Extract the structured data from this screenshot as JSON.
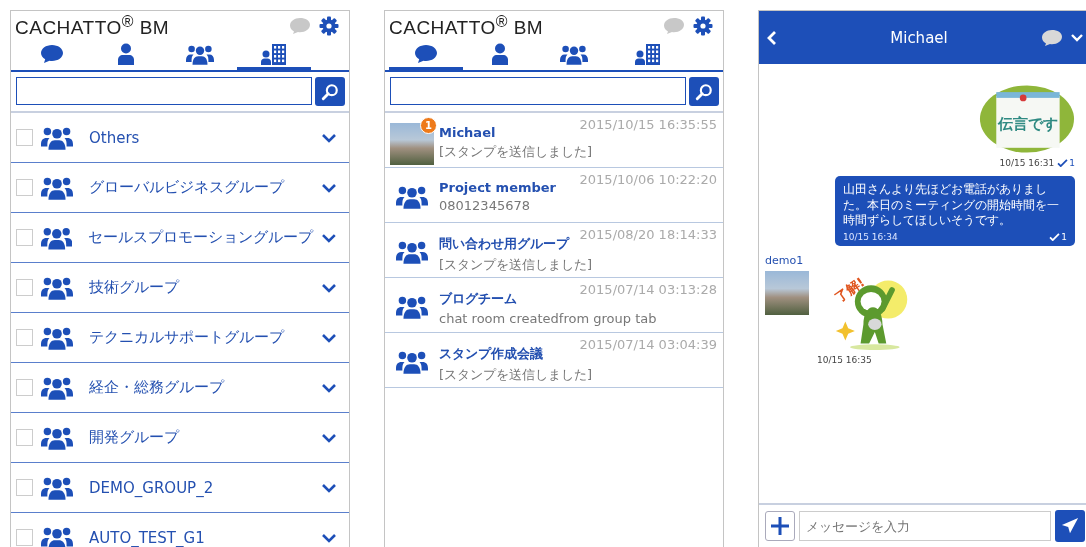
{
  "group_screen": {
    "logo": "CACHATTO$^{®}$ BM",
    "tabs": [
      {
        "kind": "chats",
        "selected": false
      },
      {
        "kind": "contacts",
        "selected": false
      },
      {
        "kind": "groups",
        "selected": false
      },
      {
        "kind": "organization",
        "selected": true
      }
    ],
    "groups": [
      {
        "name": "Others",
        "checked": false
      },
      {
        "name": "グローバルビジネスグループ",
        "checked": false
      },
      {
        "name": "セールスプロモーショングループ",
        "checked": false
      },
      {
        "name": "技術グループ",
        "checked": false
      },
      {
        "name": "テクニカルサポートグループ",
        "checked": false
      },
      {
        "name": "経企・総務グループ",
        "checked": false
      },
      {
        "name": "開発グループ",
        "checked": false
      },
      {
        "name": "DEMO_GROUP_2",
        "checked": false
      },
      {
        "name": "AUTO_TEST_G1",
        "checked": false
      }
    ]
  },
  "chat_list_screen": {
    "logo": "CACHATTO$^{®}$ BM",
    "tabs": [
      {
        "kind": "chats",
        "selected": true
      },
      {
        "kind": "contacts",
        "selected": false
      },
      {
        "kind": "groups",
        "selected": false
      },
      {
        "kind": "organization",
        "selected": false
      }
    ],
    "chats": [
      {
        "kind": "photo",
        "badge": "1",
        "name": "Michael",
        "time": "2015/10/15 16:35:55",
        "preview": "[スタンプを送信しました]"
      },
      {
        "kind": "group",
        "name": "Project member",
        "time": "2015/10/06 10:22:20",
        "preview": "08012345678"
      },
      {
        "kind": "group",
        "name": "問い合わせ用グループ",
        "time": "2015/08/20 18:14:33",
        "preview": "[スタンプを送信しました]"
      },
      {
        "kind": "group",
        "name": "ブログチーム",
        "time": "2015/07/14 03:13:28",
        "preview": "chat room createdfrom group tab"
      },
      {
        "kind": "group",
        "name": "スタンプ作成会議",
        "time": "2015/07/14 03:04:39",
        "preview": "[スタンプを送信しました]"
      }
    ]
  },
  "chat_screen": {
    "title": "Michael",
    "messages": [
      {
        "kind": "memo",
        "outgoing": true,
        "label": "伝言です",
        "time": "10/15 16:31",
        "read_count": "1"
      },
      {
        "kind": "text",
        "outgoing": true,
        "text": "山田さんより先ほどお電話がありました。本日のミーティングの開始時間を一時間ずらしてほしいそうです。",
        "time": "10/15 16:34",
        "read_count": "1"
      },
      {
        "kind": "character",
        "outgoing": false,
        "sender": "demo1",
        "label": "了解!",
        "time": "10/15 16:35"
      }
    ],
    "input": {
      "placeholder": "メッセージを入力"
    }
  }
}
